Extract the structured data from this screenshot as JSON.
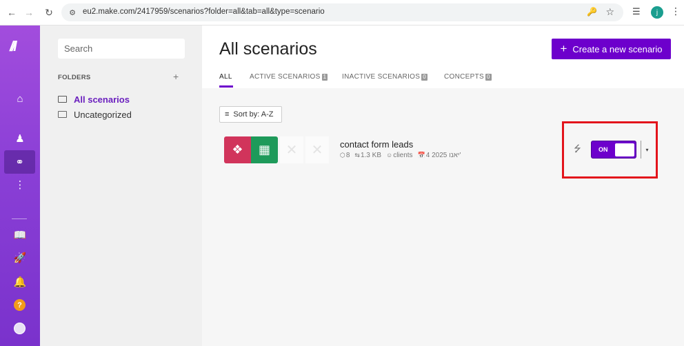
{
  "browser": {
    "url": "eu2.make.com/2417959/scenarios?folder=all&tab=all&type=scenario",
    "profile_initial": "j"
  },
  "sidebar": {
    "search_placeholder": "Search",
    "folders_heading": "FOLDERS",
    "folders": [
      {
        "label": "All scenarios",
        "active": true
      },
      {
        "label": "Uncategorized",
        "active": false
      }
    ],
    "help_label": "?"
  },
  "header": {
    "title": "All scenarios",
    "create_button_label": "Create a new scenario",
    "tabs": [
      {
        "label": "ALL",
        "count": null,
        "active": true
      },
      {
        "label": "ACTIVE SCENARIOS",
        "count": "1",
        "active": false
      },
      {
        "label": "INACTIVE SCENARIOS",
        "count": "0",
        "active": false
      },
      {
        "label": "CONCEPTS",
        "count": "0",
        "active": false
      }
    ]
  },
  "toolbar": {
    "sort_label": "Sort by: A-Z"
  },
  "scenario": {
    "name": "contact form leads",
    "modules": "8",
    "data_size": "1.3 KB",
    "folder": "clients",
    "date": "4 2025 יאנו'",
    "toggle_label": "ON",
    "enabled": true
  },
  "colors": {
    "brand": "#6d00cc",
    "webhook_tile": "#d1345b",
    "sheets_tile": "#1e9a5a",
    "highlight": "#e3141b"
  }
}
